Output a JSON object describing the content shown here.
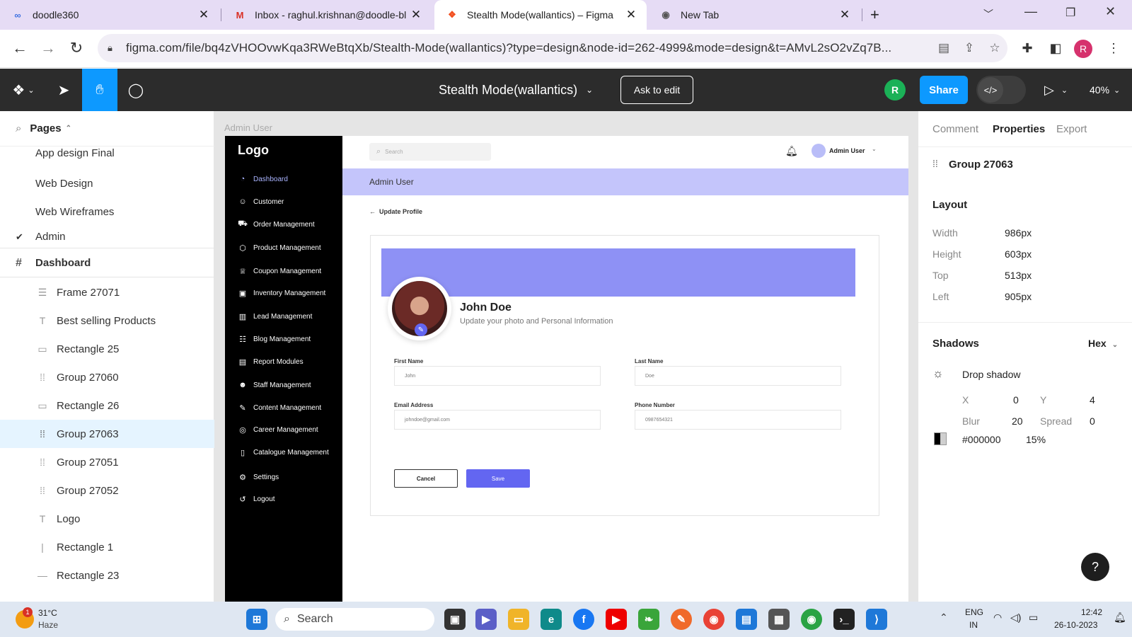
{
  "browser": {
    "tabs": [
      {
        "label": "doodle360",
        "icon": "doodle-icon"
      },
      {
        "label": "Inbox - raghul.krishnan@doodle-bl",
        "icon": "gmail-icon"
      },
      {
        "label": "Stealth Mode(wallantics) – Figma",
        "icon": "figma-icon"
      },
      {
        "label": "New Tab",
        "icon": "chrome-icon"
      }
    ],
    "url": "figma.com/file/bq4zVHOOvwKqa3RWeBtqXb/Stealth-Mode(wallantics)?type=design&node-id=262-4999&mode=design&t=AMvL2sO2vZq7B...",
    "profile_initial": "R"
  },
  "figma": {
    "file_title": "Stealth Mode(wallantics)",
    "ask_to_edit": "Ask to edit",
    "avatar": "R",
    "share": "Share",
    "zoom": "40%"
  },
  "left_panel": {
    "pages_label": "Pages",
    "pages": [
      "App design Final",
      "Web Design",
      "Web Wireframes",
      "Admin"
    ],
    "current_page_section": "Dashboard",
    "layers": [
      {
        "name": "Frame 27071",
        "type": "frame"
      },
      {
        "name": "Best selling Products",
        "type": "text"
      },
      {
        "name": "Rectangle 25",
        "type": "rect"
      },
      {
        "name": "Group 27060",
        "type": "group"
      },
      {
        "name": "Rectangle 26",
        "type": "rect"
      },
      {
        "name": "Group 27063",
        "type": "group",
        "selected": true
      },
      {
        "name": "Group 27051",
        "type": "group"
      },
      {
        "name": "Group 27052",
        "type": "group"
      },
      {
        "name": "Logo",
        "type": "text"
      },
      {
        "name": "Rectangle 1",
        "type": "vline"
      },
      {
        "name": "Rectangle 23",
        "type": "hline"
      }
    ]
  },
  "canvas": {
    "frame_label": "Admin User",
    "app": {
      "logo": "Logo",
      "nav": [
        "Dashboard",
        "Customer",
        "Order Management",
        "Product Management",
        "Coupon Management",
        "Inventory Management",
        "Lead Management",
        "Blog Management",
        "Report Modules",
        "Staff Management",
        "Content Management",
        "Career Management",
        "Catalogue Management",
        "Settings",
        "Logout"
      ],
      "search_placeholder": "Search",
      "user_name": "Admin User",
      "banner_title": "Admin User",
      "back_label": "Update Profile",
      "profile_name": "John Doe",
      "profile_subtitle": "Update your photo and Personal Information",
      "fields": {
        "first_name_label": "First Name",
        "first_name_value": "John",
        "last_name_label": "Last Name",
        "last_name_value": "Doe",
        "email_label": "Email Address",
        "email_value": "johndoe@gmail.com",
        "phone_label": "Phone Number",
        "phone_value": "0987654321"
      },
      "cancel": "Cancel",
      "save": "Save"
    }
  },
  "right_panel": {
    "tabs": [
      "Comment",
      "Properties",
      "Export"
    ],
    "selection_name": "Group 27063",
    "layout_title": "Layout",
    "layout": [
      {
        "label": "Width",
        "value": "986px"
      },
      {
        "label": "Height",
        "value": "603px"
      },
      {
        "label": "Top",
        "value": "513px"
      },
      {
        "label": "Left",
        "value": "905px"
      }
    ],
    "shadows_title": "Shadows",
    "color_mode": "Hex",
    "shadow_type": "Drop shadow",
    "shadow": {
      "x_label": "X",
      "x": "0",
      "y_label": "Y",
      "y": "4",
      "blur_label": "Blur",
      "blur": "20",
      "spread_label": "Spread",
      "spread": "0"
    },
    "color_hex": "#000000",
    "opacity": "15%"
  },
  "taskbar": {
    "weather_badge": "1",
    "temperature": "31°C",
    "weather": "Haze",
    "search": "Search",
    "lang": "ENG",
    "region": "IN",
    "time": "12:42",
    "date": "26-10-2023"
  },
  "colors": {
    "figma_toolbar": "#2c2c2c",
    "share_blue": "#0d99ff",
    "accent_purple": "#8e91f5",
    "save_button": "#6366f1",
    "selection_highlight": "#e5f4ff"
  }
}
